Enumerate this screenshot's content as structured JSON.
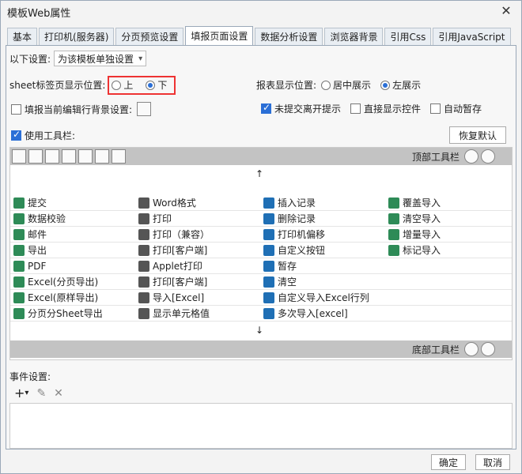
{
  "window": {
    "title": "模板Web属性",
    "close_icon": "✕"
  },
  "tabs": [
    "基本",
    "打印机(服务器)",
    "分页预览设置",
    "填报页面设置",
    "数据分析设置",
    "浏览器背景",
    "引用Css",
    "引用JavaScript"
  ],
  "settings": {
    "scope_label": "以下设置:",
    "scope_value": "为该模板单独设置",
    "sheet_label": "sheet标签页显示位置:",
    "sheet_top": "上",
    "sheet_bottom": "下",
    "report_label": "报表显示位置:",
    "report_center": "居中展示",
    "report_left": "左展示",
    "fill_bg_label": "填报当前编辑行背景设置:",
    "unsubmitted_label": "未提交离开提示",
    "direct_control_label": "直接显示控件",
    "autosave_label": "自动暂存",
    "use_toolbar_label": "使用工具栏:",
    "restore_default": "恢复默认"
  },
  "toolbar": {
    "top_label": "顶部工具栏",
    "bottom_label": "底部工具栏",
    "up_arrow": "↑",
    "down_arrow": "↓"
  },
  "buttons_grid": [
    [
      "提交",
      "Word格式",
      "插入记录",
      "覆盖导入"
    ],
    [
      "数据校验",
      "打印",
      "删除记录",
      "清空导入"
    ],
    [
      "邮件",
      "打印（兼容）",
      "打印机偏移",
      "增量导入"
    ],
    [
      "导出",
      "打印[客户端]",
      "自定义按钮",
      "标记导入"
    ],
    [
      "PDF",
      "Applet打印",
      "暂存",
      ""
    ],
    [
      "Excel(分页导出)",
      "打印[客户端]",
      "清空",
      ""
    ],
    [
      "Excel(原样导出)",
      "导入[Excel]",
      "自定义导入Excel行列",
      ""
    ],
    [
      "分页分Sheet导出",
      "显示单元格值",
      "多次导入[excel]",
      ""
    ]
  ],
  "events": {
    "label": "事件设置:",
    "add": "+",
    "add_arrow": "▾",
    "edit": "✎",
    "delete": "✕"
  },
  "footer": {
    "ok": "确定",
    "cancel": "取消"
  }
}
